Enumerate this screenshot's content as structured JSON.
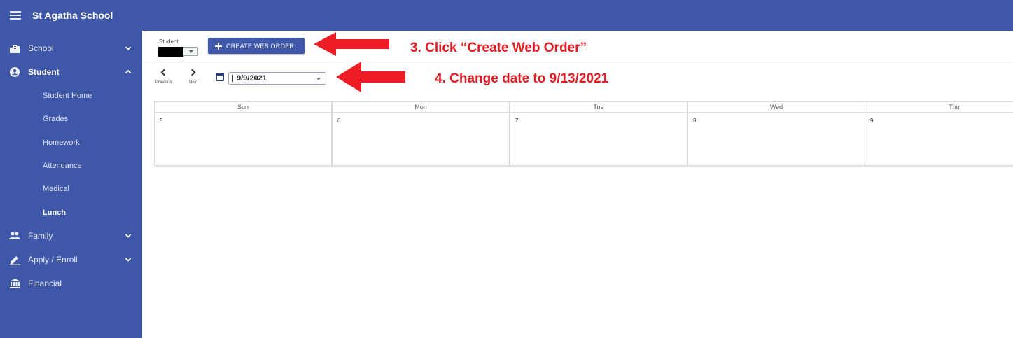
{
  "app": {
    "title": "St Agatha School"
  },
  "sidebar": {
    "items": [
      {
        "label": "School",
        "icon": "building-icon",
        "expanded": false
      },
      {
        "label": "Student",
        "icon": "account-circle-icon",
        "expanded": true
      },
      {
        "label": "Family",
        "icon": "people-icon",
        "expanded": false
      },
      {
        "label": "Apply / Enroll",
        "icon": "pencil-icon",
        "expanded": false
      },
      {
        "label": "Financial",
        "icon": "bank-icon",
        "expanded": null
      }
    ],
    "student_subitems": [
      "Student Home",
      "Grades",
      "Homework",
      "Attendance",
      "Medical",
      "Lunch"
    ],
    "active_subitem": "Lunch"
  },
  "toolbar": {
    "student_label": "Student",
    "create_button_label": "CREATE WEB ORDER",
    "previous_label": "Previous",
    "next_label": "Next",
    "date_value": "9/9/2021"
  },
  "annotations": {
    "step3": "3.   Click “Create Web Order”",
    "step4": "4.   Change date to 9/13/2021",
    "color": "#e31b23"
  },
  "calendar": {
    "days": [
      {
        "name": "Sun",
        "date": "5"
      },
      {
        "name": "Mon",
        "date": "6"
      },
      {
        "name": "Tue",
        "date": "7"
      },
      {
        "name": "Wed",
        "date": "8"
      },
      {
        "name": "Thu",
        "date": "9"
      }
    ]
  },
  "colors": {
    "brand": "#3f57a8",
    "annotation": "#e31b23"
  }
}
